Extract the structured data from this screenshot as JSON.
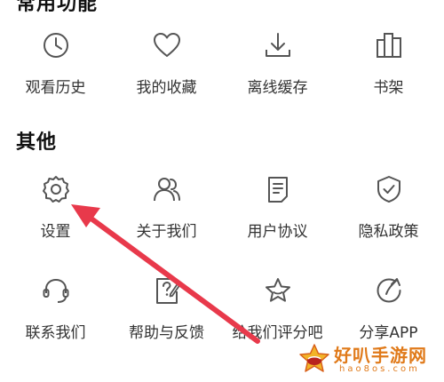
{
  "sections": {
    "common": {
      "title": "常用功能"
    },
    "other": {
      "title": "其他"
    }
  },
  "common_items": [
    {
      "label": "观看历史",
      "icon": "clock-icon"
    },
    {
      "label": "我的收藏",
      "icon": "heart-icon"
    },
    {
      "label": "离线缓存",
      "icon": "download-icon"
    },
    {
      "label": "书架",
      "icon": "bookshelf-icon"
    }
  ],
  "other_items": [
    {
      "label": "设置",
      "icon": "gear-icon"
    },
    {
      "label": "关于我们",
      "icon": "users-icon"
    },
    {
      "label": "用户协议",
      "icon": "document-icon"
    },
    {
      "label": "隐私政策",
      "icon": "shield-check-icon"
    },
    {
      "label": "联系我们",
      "icon": "headset-icon"
    },
    {
      "label": "帮助与反馈",
      "icon": "help-edit-icon"
    },
    {
      "label": "给我们评分吧",
      "icon": "star-icon"
    },
    {
      "label": "分享APP",
      "icon": "share-icon"
    }
  ],
  "watermark": {
    "name": "好叭手游网",
    "domain": "hao8os.com"
  },
  "colors": {
    "arrow": "#e8394b",
    "icon": "#555555",
    "watermark": "#e07a1a"
  }
}
